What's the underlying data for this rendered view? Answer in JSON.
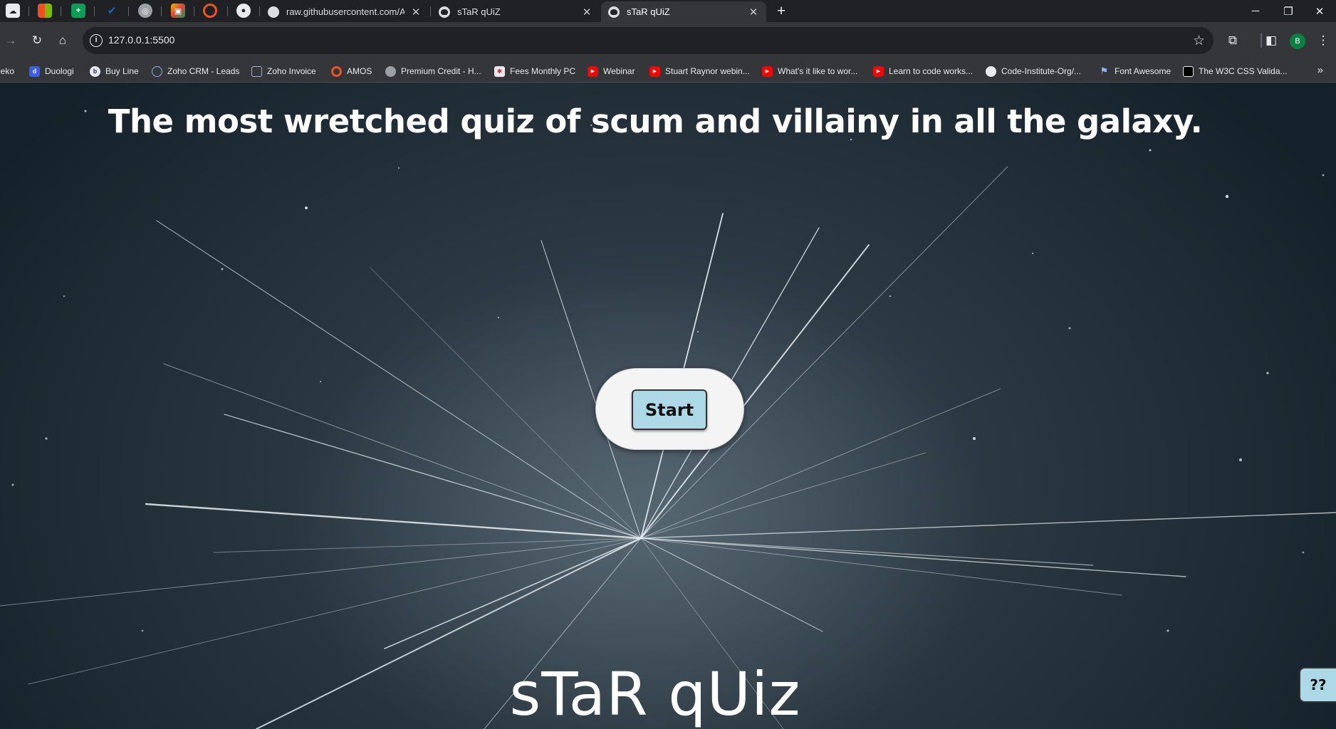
{
  "browser": {
    "tabs": [
      {
        "title": "raw.githubusercontent.com/AllW"
      },
      {
        "title": "sTaR qUiZ"
      },
      {
        "title": "sTaR qUiZ",
        "active": true
      }
    ],
    "address": "127.0.0.1:5500",
    "profile_initial": "B"
  },
  "bookmarks": [
    {
      "label": "Deko",
      "icon": "deko-icon"
    },
    {
      "label": "Duologi",
      "icon": "duologi-icon"
    },
    {
      "label": "Buy Line",
      "icon": "buy-line-icon"
    },
    {
      "label": "Zoho CRM - Leads",
      "icon": "zoho-crm-icon"
    },
    {
      "label": "Zoho Invoice",
      "icon": "zoho-invoice-icon"
    },
    {
      "label": "AMOS",
      "icon": "amos-icon"
    },
    {
      "label": "Premium Credit - H...",
      "icon": "globe-icon"
    },
    {
      "label": "Fees Monthly PC",
      "icon": "fees-icon"
    },
    {
      "label": "Webinar",
      "icon": "youtube-icon"
    },
    {
      "label": "Stuart Raynor webin...",
      "icon": "youtube-icon"
    },
    {
      "label": "What's it like to wor...",
      "icon": "youtube-icon"
    },
    {
      "label": "Learn to code works...",
      "icon": "youtube-icon"
    },
    {
      "label": "Code-Institute-Org/...",
      "icon": "github-icon"
    },
    {
      "label": "Font Awesome",
      "icon": "flag-icon"
    },
    {
      "label": "The W3C CSS Valida...",
      "icon": "w3c-icon"
    }
  ],
  "page": {
    "headline": "The most wretched quiz of scum and villainy in all the galaxy.",
    "start_button": "Start",
    "logo_text": "sTaR qUiz",
    "help_button": "??"
  },
  "colors": {
    "button_fill": "#add8e6",
    "pill_fill": "#f4f4f4",
    "background": "#2a3741"
  }
}
